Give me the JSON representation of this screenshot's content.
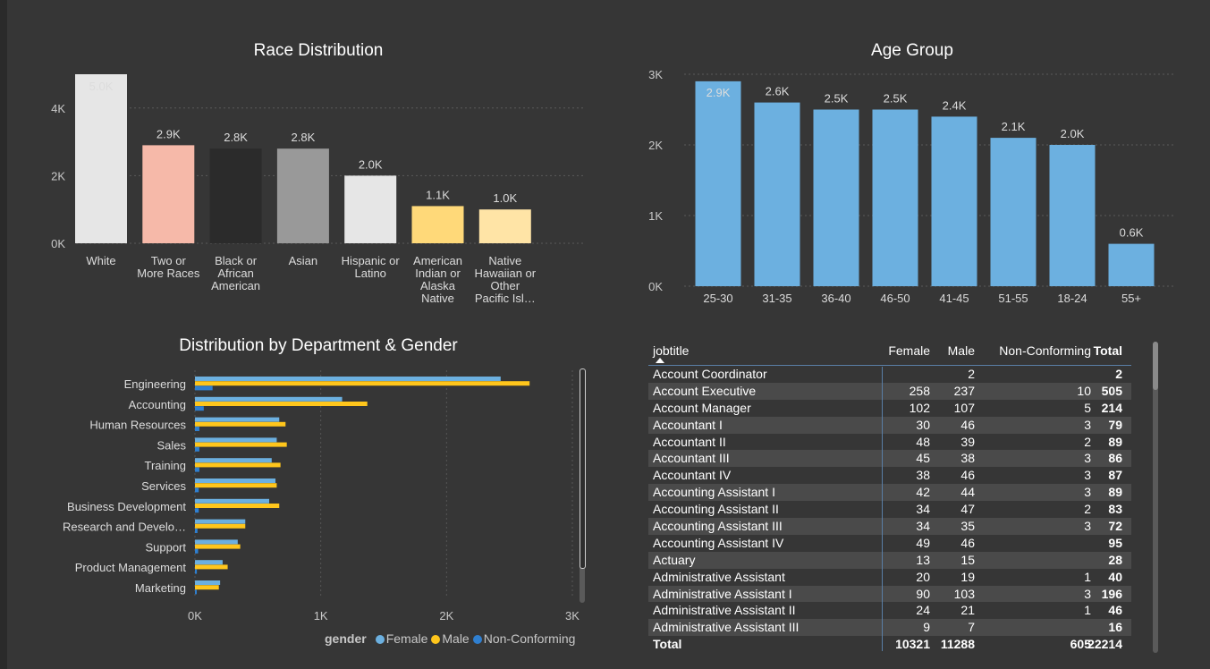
{
  "chart_data": [
    {
      "type": "bar",
      "title": "Race Distribution",
      "categories": [
        "White",
        "Two or More Races",
        "Black or African American",
        "Asian",
        "Hispanic or Latino",
        "American Indian or Alaska Native",
        "Native Hawaiian or Other Pacific Isl…"
      ],
      "category_lines": [
        [
          "White"
        ],
        [
          "Two or",
          "More Races"
        ],
        [
          "Black or",
          "African",
          "American"
        ],
        [
          "Asian"
        ],
        [
          "Hispanic or",
          "Latino"
        ],
        [
          "American",
          "Indian or",
          "Alaska",
          "Native"
        ],
        [
          "Native",
          "Hawaiian or",
          "Other",
          "Pacific Isl…"
        ]
      ],
      "values": [
        5000,
        2900,
        2800,
        2800,
        2000,
        1100,
        1000
      ],
      "data_labels": [
        "5.0K",
        "2.9K",
        "2.8K",
        "2.8K",
        "2.0K",
        "1.1K",
        "1.0K"
      ],
      "colors": [
        "#e6e6e6",
        "#f6b9a9",
        "#2b2b2b",
        "#999999",
        "#e6e6e6",
        "#ffd979",
        "#ffe4a6"
      ],
      "yticks": [
        0,
        2000,
        4000
      ],
      "ytick_labels": [
        "0K",
        "2K",
        "4K"
      ],
      "ylim": [
        0,
        5000
      ],
      "grid": true
    },
    {
      "type": "bar",
      "title": "Age Group",
      "categories": [
        "25-30",
        "31-35",
        "36-40",
        "46-50",
        "41-45",
        "51-55",
        "18-24",
        "55+"
      ],
      "values": [
        2900,
        2600,
        2500,
        2500,
        2400,
        2100,
        2000,
        600
      ],
      "data_labels": [
        "2.9K",
        "2.6K",
        "2.5K",
        "2.5K",
        "2.4K",
        "2.1K",
        "2.0K",
        "0.6K"
      ],
      "color": "#6cb0e0",
      "yticks": [
        0,
        1000,
        2000,
        3000
      ],
      "ytick_labels": [
        "0K",
        "1K",
        "2K",
        "3K"
      ],
      "ylim": [
        0,
        3000
      ],
      "grid": true
    },
    {
      "type": "bar",
      "orientation": "horizontal",
      "title": "Distribution by Department & Gender",
      "categories": [
        "Engineering",
        "Accounting",
        "Human Resources",
        "Sales",
        "Training",
        "Services",
        "Business Development",
        "Research and Develo…",
        "Support",
        "Product Management",
        "Marketing"
      ],
      "series": [
        {
          "name": "Female",
          "color": "#6cb0e0",
          "values": [
            2430,
            1170,
            670,
            650,
            610,
            640,
            590,
            400,
            340,
            220,
            200
          ]
        },
        {
          "name": "Male",
          "color": "#ffc61c",
          "values": [
            2660,
            1370,
            720,
            730,
            680,
            650,
            670,
            400,
            360,
            260,
            190
          ]
        },
        {
          "name": "Non-Conforming",
          "color": "#2f7fd0",
          "values": [
            140,
            70,
            35,
            35,
            35,
            30,
            30,
            20,
            25,
            15,
            10
          ]
        }
      ],
      "xticks": [
        0,
        1000,
        2000,
        3000
      ],
      "xtick_labels": [
        "0K",
        "1K",
        "2K",
        "3K"
      ],
      "xlim": [
        0,
        3000
      ],
      "legend_title": "gender",
      "legend_position": "bottom-right",
      "grid": true
    }
  ],
  "table": {
    "headers": {
      "jobtitle": "jobtitle",
      "female": "Female",
      "male": "Male",
      "nonconf": "Non-Conforming",
      "total": "Total"
    },
    "rows": [
      [
        "Account Coordinator",
        "",
        "2",
        "",
        "2"
      ],
      [
        "Account Executive",
        "258",
        "237",
        "10",
        "505"
      ],
      [
        "Account Manager",
        "102",
        "107",
        "5",
        "214"
      ],
      [
        "Accountant I",
        "30",
        "46",
        "3",
        "79"
      ],
      [
        "Accountant II",
        "48",
        "39",
        "2",
        "89"
      ],
      [
        "Accountant III",
        "45",
        "38",
        "3",
        "86"
      ],
      [
        "Accountant IV",
        "38",
        "46",
        "3",
        "87"
      ],
      [
        "Accounting Assistant I",
        "42",
        "44",
        "3",
        "89"
      ],
      [
        "Accounting Assistant II",
        "34",
        "47",
        "2",
        "83"
      ],
      [
        "Accounting Assistant III",
        "34",
        "35",
        "3",
        "72"
      ],
      [
        "Accounting Assistant IV",
        "49",
        "46",
        "",
        "95"
      ],
      [
        "Actuary",
        "13",
        "15",
        "",
        "28"
      ],
      [
        "Administrative Assistant",
        "20",
        "19",
        "1",
        "40"
      ],
      [
        "Administrative Assistant I",
        "90",
        "103",
        "3",
        "196"
      ],
      [
        "Administrative Assistant II",
        "24",
        "21",
        "1",
        "46"
      ],
      [
        "Administrative Assistant III",
        "9",
        "7",
        "",
        "16"
      ]
    ],
    "total": [
      "Total",
      "10321",
      "11288",
      "605",
      "22214"
    ]
  }
}
